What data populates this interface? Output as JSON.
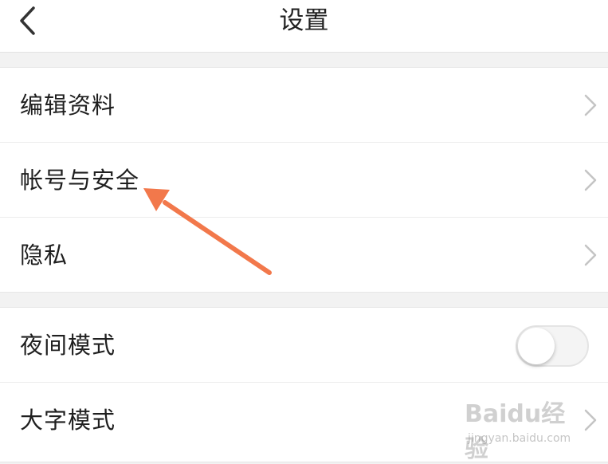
{
  "header": {
    "title": "设置",
    "back_icon": "chevron-left-icon"
  },
  "groups": [
    {
      "rows": [
        {
          "label": "编辑资料",
          "control": "chevron-right-icon"
        },
        {
          "label": "帐号与安全",
          "control": "chevron-right-icon"
        },
        {
          "label": "隐私",
          "control": "chevron-right-icon"
        }
      ]
    },
    {
      "rows": [
        {
          "label": "夜间模式",
          "control": "toggle",
          "toggle_on": false
        },
        {
          "label": "大字模式",
          "control": "chevron-right-icon"
        }
      ]
    }
  ],
  "annotation": {
    "type": "arrow",
    "color": "#f2784b",
    "points_to": "帐号与安全"
  },
  "watermark": {
    "brand": "Baidu经验",
    "url": "jingyan.baidu.com"
  },
  "colors": {
    "background": "#f2f2f2",
    "surface": "#ffffff",
    "text": "#222222",
    "chevron": "#c4c4c4",
    "accent_arrow": "#f2784b"
  }
}
